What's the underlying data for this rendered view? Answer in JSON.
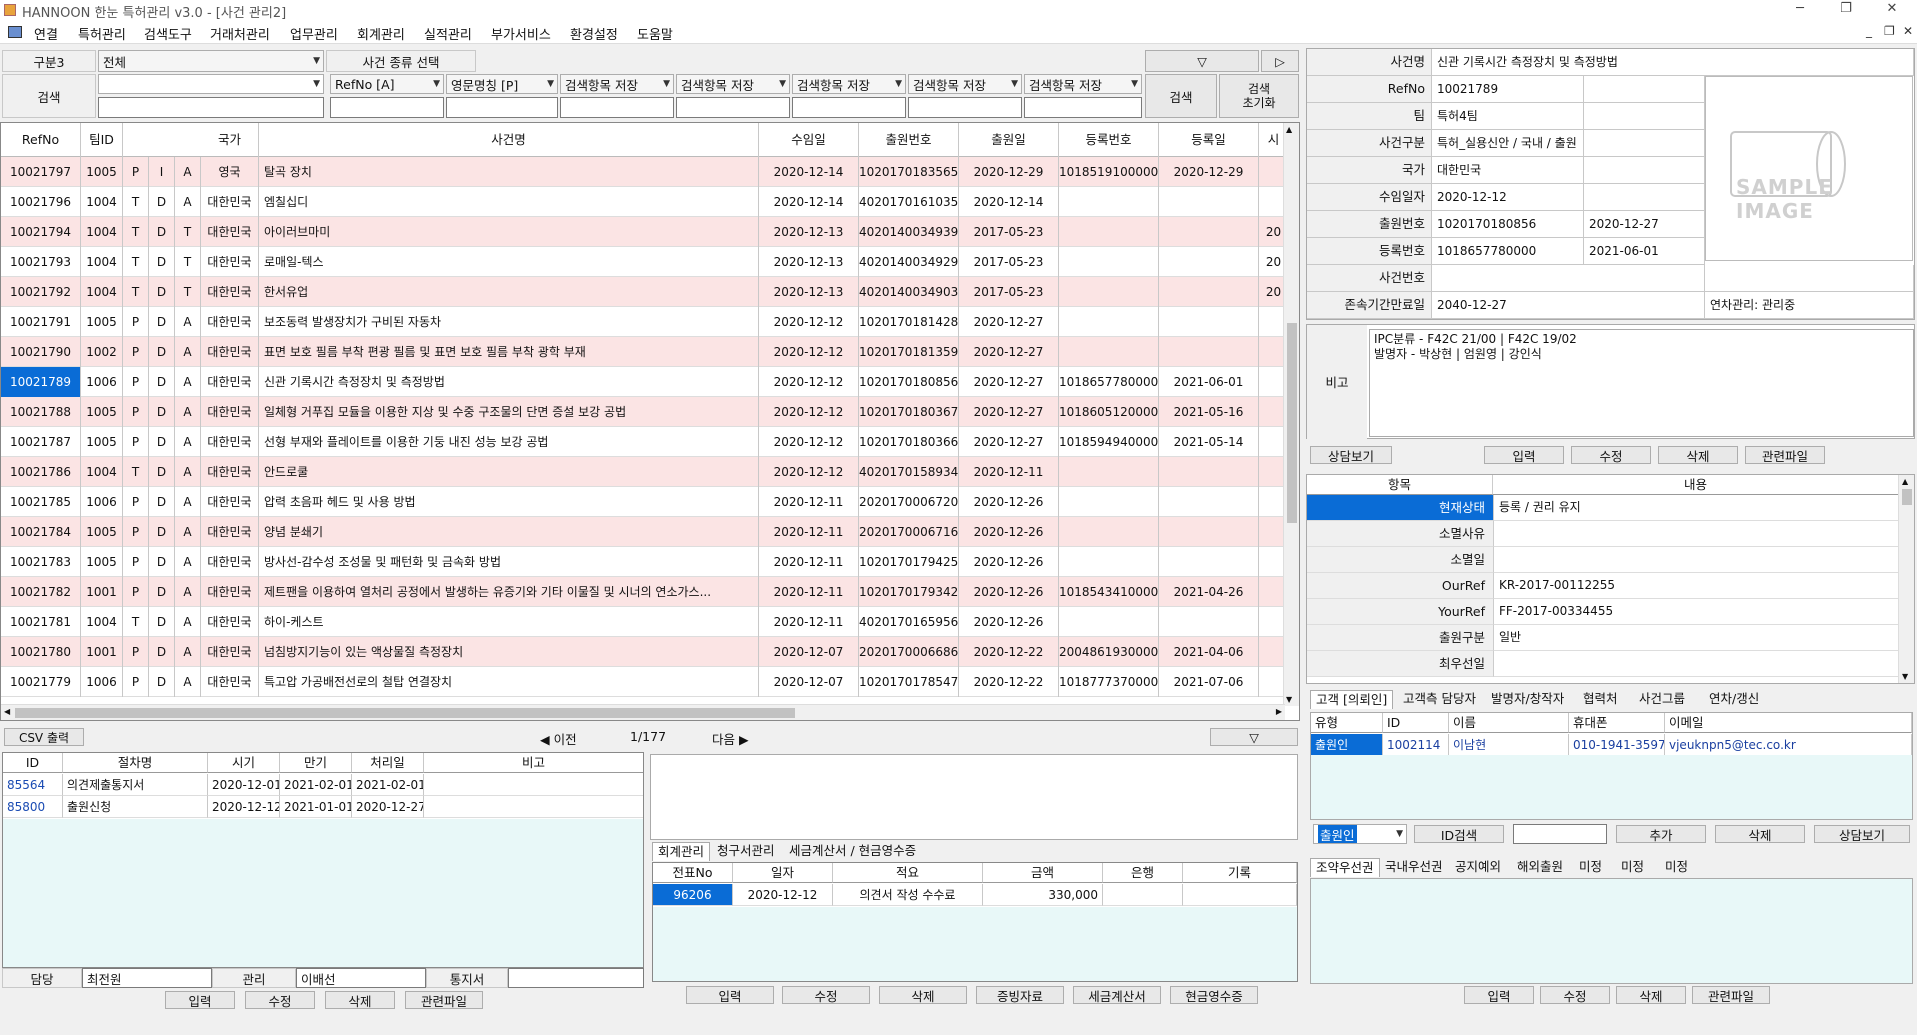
{
  "window": {
    "title": "HANNOON 한눈 특허관리 v3.0 - [사건 관리2]",
    "minimize": "─",
    "maximize": "❐",
    "close": "✕"
  },
  "menu": {
    "items": [
      "연결",
      "특허관리",
      "검색도구",
      "거래처관리",
      "업무관리",
      "회계관리",
      "실적관리",
      "부가서비스",
      "환경설정",
      "도움말"
    ],
    "child_min": "_",
    "child_restore": "❐",
    "child_close": "✕"
  },
  "search": {
    "category_label": "구분3",
    "category_value": "전체",
    "case_type_label": "사건 종류 선택",
    "search_label": "검색",
    "field_combos": [
      "RefNo [A]",
      "영문명칭 [P]",
      "검색항목 저장",
      "검색항목 저장",
      "검색항목 저장",
      "검색항목 저장",
      "검색항목 저장",
      "검색항목 저장"
    ],
    "down_btn": "▽",
    "play_btn": "▷",
    "search_btn": "검색",
    "reset_btn": "검색\n초기화"
  },
  "grid": {
    "headers": [
      "RefNo",
      "팀ID",
      "",
      "",
      "",
      "국가",
      "사건명",
      "수임일",
      "출원번호",
      "출원일",
      "등록번호",
      "등록일",
      "시"
    ],
    "rows": [
      {
        "ref": "10021797",
        "team": "1005",
        "a": "P",
        "b": "I",
        "c": "A",
        "country": "영국",
        "name": "탈곡 장치",
        "recv": "2020-12-14",
        "appno": "1020170183565",
        "appdate": "2020-12-29",
        "regno": "1018519100000",
        "regdate": "2020-12-29",
        "x": ""
      },
      {
        "ref": "10021796",
        "team": "1004",
        "a": "T",
        "b": "D",
        "c": "A",
        "country": "대한민국",
        "name": "엠칠십디",
        "recv": "2020-12-14",
        "appno": "4020170161035",
        "appdate": "2020-12-14",
        "regno": "",
        "regdate": "",
        "x": ""
      },
      {
        "ref": "10021794",
        "team": "1004",
        "a": "T",
        "b": "D",
        "c": "T",
        "country": "대한민국",
        "name": "아이러브마미",
        "recv": "2020-12-13",
        "appno": "4020140034939",
        "appdate": "2017-05-23",
        "regno": "",
        "regdate": "",
        "x": "20"
      },
      {
        "ref": "10021793",
        "team": "1004",
        "a": "T",
        "b": "D",
        "c": "T",
        "country": "대한민국",
        "name": "로매일-텍스",
        "recv": "2020-12-13",
        "appno": "4020140034929",
        "appdate": "2017-05-23",
        "regno": "",
        "regdate": "",
        "x": "20"
      },
      {
        "ref": "10021792",
        "team": "1004",
        "a": "T",
        "b": "D",
        "c": "T",
        "country": "대한민국",
        "name": "한서유업",
        "recv": "2020-12-13",
        "appno": "4020140034903",
        "appdate": "2017-05-23",
        "regno": "",
        "regdate": "",
        "x": "20"
      },
      {
        "ref": "10021791",
        "team": "1005",
        "a": "P",
        "b": "D",
        "c": "A",
        "country": "대한민국",
        "name": "보조동력 발생장치가 구비된 자동차",
        "recv": "2020-12-12",
        "appno": "1020170181428",
        "appdate": "2020-12-27",
        "regno": "",
        "regdate": "",
        "x": ""
      },
      {
        "ref": "10021790",
        "team": "1002",
        "a": "P",
        "b": "D",
        "c": "A",
        "country": "대한민국",
        "name": "표면 보호 필름 부착 편광 필름 및 표면 보호 필름 부착 광학 부재",
        "recv": "2020-12-12",
        "appno": "1020170181359",
        "appdate": "2020-12-27",
        "regno": "",
        "regdate": "",
        "x": ""
      },
      {
        "ref": "10021789",
        "team": "1006",
        "a": "P",
        "b": "D",
        "c": "A",
        "country": "대한민국",
        "name": "신관 기록시간 측정장치 및 측정방법",
        "recv": "2020-12-12",
        "appno": "1020170180856",
        "appdate": "2020-12-27",
        "regno": "1018657780000",
        "regdate": "2021-06-01",
        "x": ""
      },
      {
        "ref": "10021788",
        "team": "1005",
        "a": "P",
        "b": "D",
        "c": "A",
        "country": "대한민국",
        "name": "일체형 거푸집 모듈을 이용한 지상 및 수중 구조물의 단면 증설 보강 공법",
        "recv": "2020-12-12",
        "appno": "1020170180367",
        "appdate": "2020-12-27",
        "regno": "1018605120000",
        "regdate": "2021-05-16",
        "x": ""
      },
      {
        "ref": "10021787",
        "team": "1005",
        "a": "P",
        "b": "D",
        "c": "A",
        "country": "대한민국",
        "name": "선형 부재와 플레이트를 이용한 기둥 내진 성능 보강 공법",
        "recv": "2020-12-12",
        "appno": "1020170180366",
        "appdate": "2020-12-27",
        "regno": "1018594940000",
        "regdate": "2021-05-14",
        "x": ""
      },
      {
        "ref": "10021786",
        "team": "1004",
        "a": "T",
        "b": "D",
        "c": "A",
        "country": "대한민국",
        "name": "안드로쿨",
        "recv": "2020-12-12",
        "appno": "4020170158934",
        "appdate": "2020-12-11",
        "regno": "",
        "regdate": "",
        "x": ""
      },
      {
        "ref": "10021785",
        "team": "1006",
        "a": "P",
        "b": "D",
        "c": "A",
        "country": "대한민국",
        "name": "압력 초음파 헤드 및 사용 방법",
        "recv": "2020-12-11",
        "appno": "2020170006720",
        "appdate": "2020-12-26",
        "regno": "",
        "regdate": "",
        "x": ""
      },
      {
        "ref": "10021784",
        "team": "1005",
        "a": "P",
        "b": "D",
        "c": "A",
        "country": "대한민국",
        "name": "양념 분쇄기",
        "recv": "2020-12-11",
        "appno": "2020170006716",
        "appdate": "2020-12-26",
        "regno": "",
        "regdate": "",
        "x": ""
      },
      {
        "ref": "10021783",
        "team": "1005",
        "a": "P",
        "b": "D",
        "c": "A",
        "country": "대한민국",
        "name": "방사선-감수성 조성물 및 패턴화 및 금속화 방법",
        "recv": "2020-12-11",
        "appno": "1020170179425",
        "appdate": "2020-12-26",
        "regno": "",
        "regdate": "",
        "x": ""
      },
      {
        "ref": "10021782",
        "team": "1001",
        "a": "P",
        "b": "D",
        "c": "A",
        "country": "대한민국",
        "name": "제트팬을 이용하여 열처리 공정에서 발생하는 유증기와 기타 이물질 및 시너의 연소가스...",
        "recv": "2020-12-11",
        "appno": "1020170179342",
        "appdate": "2020-12-26",
        "regno": "1018543410000",
        "regdate": "2021-04-26",
        "x": ""
      },
      {
        "ref": "10021781",
        "team": "1004",
        "a": "T",
        "b": "D",
        "c": "A",
        "country": "대한민국",
        "name": "하이-케스트",
        "recv": "2020-12-11",
        "appno": "4020170165956",
        "appdate": "2020-12-26",
        "regno": "",
        "regdate": "",
        "x": ""
      },
      {
        "ref": "10021780",
        "team": "1001",
        "a": "P",
        "b": "D",
        "c": "A",
        "country": "대한민국",
        "name": "넘침방지기능이 있는 액상물질 측정장치",
        "recv": "2020-12-07",
        "appno": "2020170006686",
        "appdate": "2020-12-22",
        "regno": "2004861930000",
        "regdate": "2021-04-06",
        "x": ""
      },
      {
        "ref": "10021779",
        "team": "1006",
        "a": "P",
        "b": "D",
        "c": "A",
        "country": "대한민국",
        "name": "특고압 가공배전선로의 철탑 연결장치",
        "recv": "2020-12-07",
        "appno": "1020170178547",
        "appdate": "2020-12-22",
        "regno": "1018777370000",
        "regdate": "2021-07-06",
        "x": ""
      }
    ],
    "selected_index": 7
  },
  "pager": {
    "csv": "CSV 출력",
    "prev": "◀ 이전",
    "page": "1/177",
    "next": "다음 ▶",
    "down": "▽"
  },
  "procedures": {
    "headers": [
      "ID",
      "절차명",
      "시기",
      "만기",
      "처리일",
      "비고"
    ],
    "rows": [
      {
        "id": "85564",
        "name": "의견제출통지서",
        "time": "2020-12-01",
        "due": "2021-02-01",
        "done": "2021-02-01",
        "note": ""
      },
      {
        "id": "85800",
        "name": "출원신청",
        "time": "2020-12-12",
        "due": "2021-01-01",
        "done": "2020-12-27",
        "note": ""
      }
    ],
    "footer": {
      "owner_label": "담당",
      "owner": "최전원",
      "manager_label": "관리",
      "manager": "이배선",
      "notice": "통지서"
    },
    "buttons": [
      "입력",
      "수정",
      "삭제",
      "관련파일"
    ]
  },
  "accounting": {
    "tabs": [
      "회계관리",
      "청구서관리",
      "세금계산서 / 현금영수증"
    ],
    "headers": [
      "전표No",
      "일자",
      "적요",
      "금액",
      "은행",
      "기록"
    ],
    "rows": [
      {
        "no": "96206",
        "date": "2020-12-12",
        "desc": "의견서 작성 수수료",
        "amount": "330,000",
        "bank": "",
        "rec": ""
      }
    ],
    "buttons": [
      "입력",
      "수정",
      "삭제",
      "증빙자료",
      "세금계산서",
      "현금영수증"
    ]
  },
  "detail": {
    "fields": [
      {
        "label": "사건명",
        "value": "신관 기록시간 측정장치 및 측정방법",
        "extra": ""
      },
      {
        "label": "RefNo",
        "value": "10021789",
        "extra": ""
      },
      {
        "label": "팀",
        "value": "특허4팀",
        "extra": ""
      },
      {
        "label": "사건구분",
        "value": "특허_실용신안 / 국내 / 출원",
        "extra": ""
      },
      {
        "label": "국가",
        "value": "대한민국",
        "extra": ""
      },
      {
        "label": "수임일자",
        "value": "2020-12-12",
        "extra": ""
      },
      {
        "label": "출원번호",
        "value": "1020170180856",
        "extra": "2020-12-27"
      },
      {
        "label": "등록번호",
        "value": "1018657780000",
        "extra": "2021-06-01"
      },
      {
        "label": "사건번호",
        "value": "",
        "extra": ""
      },
      {
        "label": "존속기간만료일",
        "value": "2040-12-27",
        "extra": "연차관리: 관리중"
      }
    ],
    "sample_image": "SAMPLE IMAGE",
    "memo_label": "비고",
    "memo_lines": [
      "IPC분류 - F42C 21/00 | F42C 19/02",
      "발명자 - 박상현 | 엄원영 | 강인식"
    ],
    "buttons": [
      "상담보기",
      "입력",
      "수정",
      "삭제",
      "관련파일"
    ]
  },
  "properties": {
    "headers": [
      "항목",
      "내용"
    ],
    "rows": [
      {
        "label": "현재상태",
        "value": "등록 / 권리 유지"
      },
      {
        "label": "소멸사유",
        "value": ""
      },
      {
        "label": "소멸일",
        "value": ""
      },
      {
        "label": "OurRef",
        "value": "KR-2017-00112255"
      },
      {
        "label": "YourRef",
        "value": "FF-2017-00334455"
      },
      {
        "label": "출원구분",
        "value": "일반"
      },
      {
        "label": "최우선일",
        "value": ""
      }
    ]
  },
  "clients": {
    "tabs": [
      "고객 [의뢰인]",
      "고객측 담당자",
      "발명자/창작자",
      "협력처",
      "사건그룹",
      "연차/갱신"
    ],
    "headers": [
      "유형",
      "ID",
      "이름",
      "휴대폰",
      "이메일"
    ],
    "rows": [
      {
        "type": "출원인",
        "id": "1002114",
        "name": "이남현",
        "phone": "010-1941-3597",
        "email": "vjeuknpn5@tec.co.kr"
      }
    ],
    "type_select": "출원인",
    "id_search": "ID검색",
    "buttons": [
      "추가",
      "삭제",
      "상담보기"
    ]
  },
  "priority": {
    "tabs": [
      "조약우선권",
      "국내우선권",
      "공지예외",
      "해외출원",
      "미정",
      "미정",
      "미정"
    ],
    "buttons": [
      "입력",
      "수정",
      "삭제",
      "관련파일"
    ]
  }
}
